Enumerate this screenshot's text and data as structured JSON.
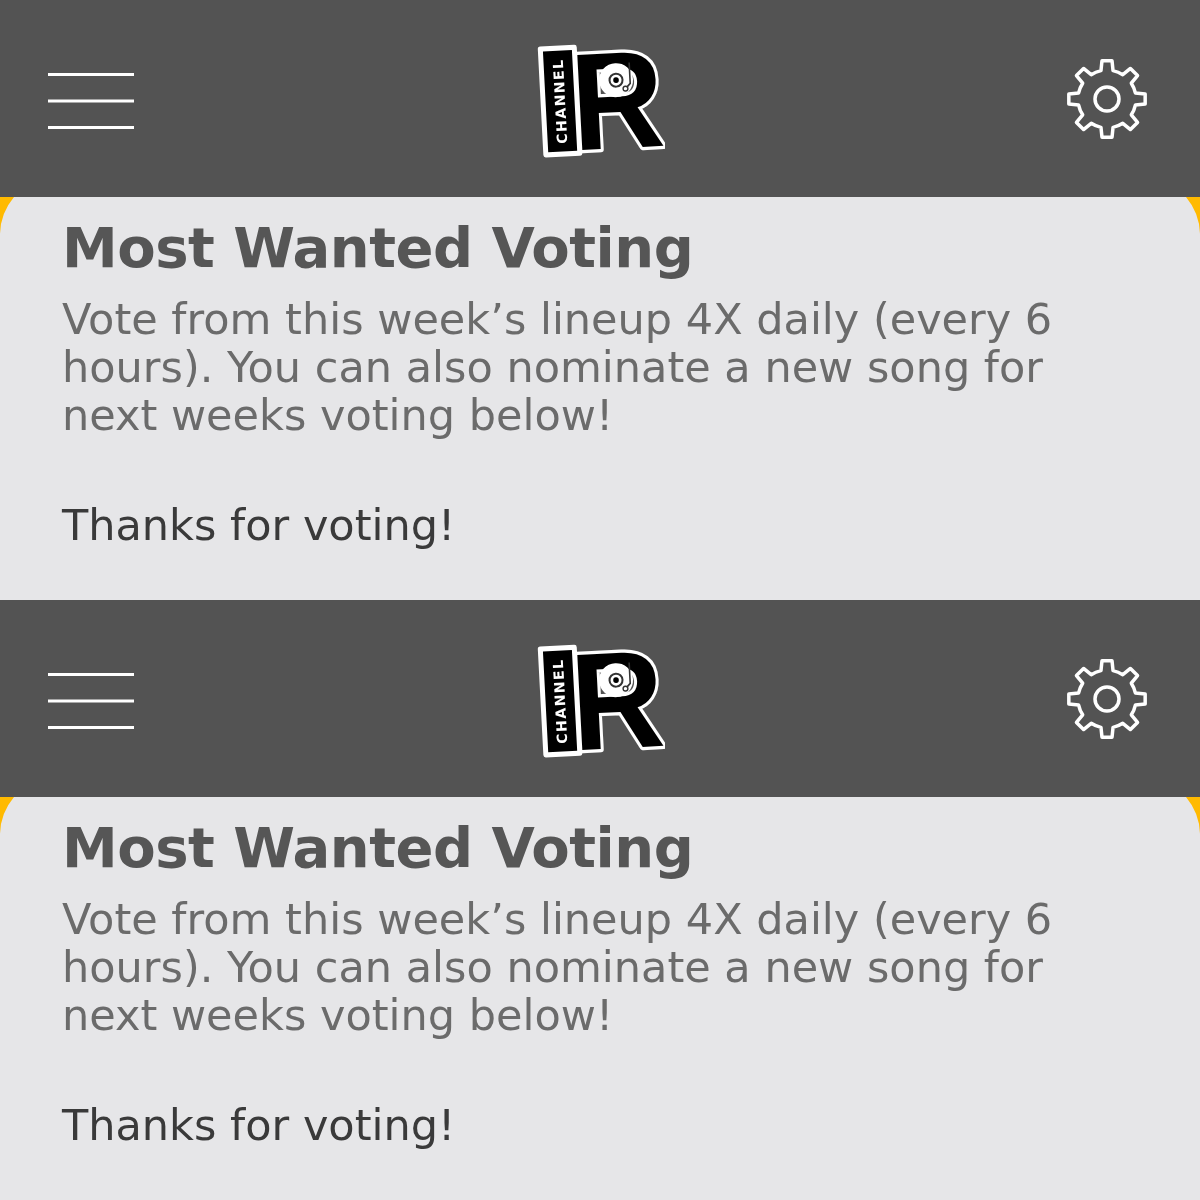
{
  "screens": [
    {
      "header": {
        "logo": {
          "letter": "R",
          "word": "CHANNEL"
        }
      },
      "panel": {
        "title": "Most Wanted Voting",
        "description": "Vote from this week’s lineup 4X daily (every 6 hours). You can also nominate a new song for next weeks voting below!",
        "message": "Thanks for voting!"
      }
    },
    {
      "header": {
        "logo": {
          "letter": "R",
          "word": "CHANNEL"
        }
      },
      "panel": {
        "title": "Most Wanted Voting",
        "description": "Vote from this week’s lineup 4X daily (every 6 hours). You can also nominate a new song for next weeks voting below!",
        "message": "Thanks for voting!"
      }
    }
  ]
}
